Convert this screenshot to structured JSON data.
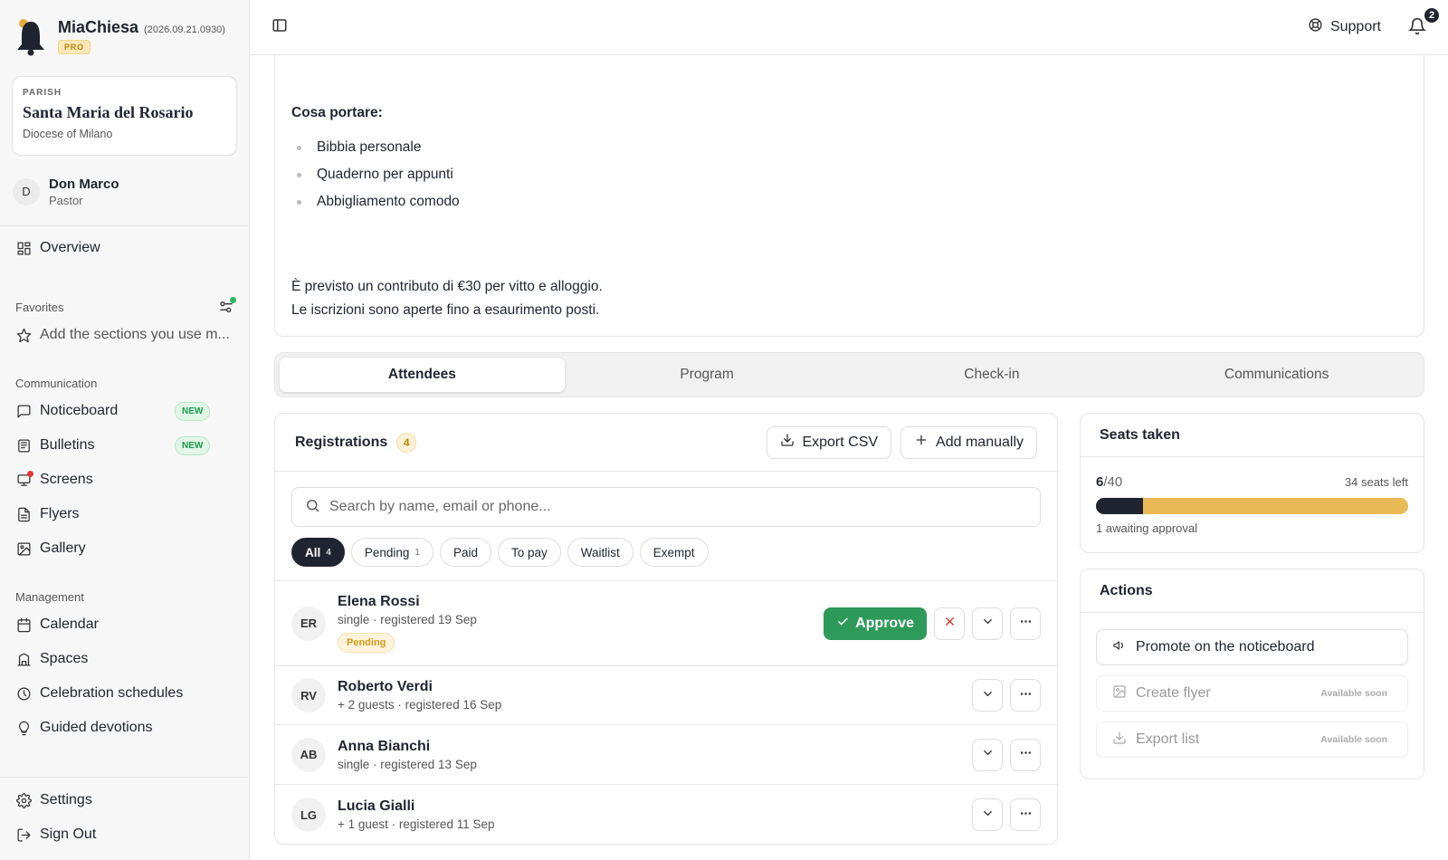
{
  "brand": {
    "name": "MiaChiesa",
    "version": "(2026.09.21.0930)",
    "tier": "PRO"
  },
  "parish": {
    "label": "PARISH",
    "name": "Santa Maria del Rosario",
    "diocese": "Diocese of Milano"
  },
  "user": {
    "initial": "D",
    "name": "Don Marco",
    "role": "Pastor"
  },
  "nav": {
    "overview": "Overview",
    "favorites_label": "Favorites",
    "favorites_hint": "Add the sections you use m...",
    "communication_label": "Communication",
    "noticeboard": "Noticeboard",
    "bulletins": "Bulletins",
    "new_badge": "NEW",
    "screens": "Screens",
    "flyers": "Flyers",
    "gallery": "Gallery",
    "management_label": "Management",
    "calendar": "Calendar",
    "spaces": "Spaces",
    "celebration": "Celebration schedules",
    "devotions": "Guided devotions",
    "settings": "Settings",
    "signout": "Sign Out"
  },
  "topbar": {
    "support": "Support",
    "notifications": "2"
  },
  "description": {
    "heading": "Cosa portare:",
    "items": [
      "Bibbia personale",
      "Quaderno per appunti",
      "Abbigliamento comodo"
    ],
    "line1": "È previsto un contributo di €30 per vitto e alloggio.",
    "line2": "Le iscrizioni sono aperte fino a esaurimento posti."
  },
  "tabs": [
    "Attendees",
    "Program",
    "Check-in",
    "Communications"
  ],
  "registrations": {
    "title": "Registrations",
    "count": "4",
    "export": "Export CSV",
    "add": "Add manually",
    "search_placeholder": "Search by name, email or phone...",
    "filters": [
      {
        "label": "All",
        "count": "4"
      },
      {
        "label": "Pending",
        "count": "1"
      },
      {
        "label": "Paid",
        "count": ""
      },
      {
        "label": "To pay",
        "count": ""
      },
      {
        "label": "Waitlist",
        "count": ""
      },
      {
        "label": "Exempt",
        "count": ""
      }
    ],
    "approve": "Approve",
    "pending_badge": "Pending",
    "rows": [
      {
        "initials": "ER",
        "name": "Elena Rossi",
        "meta": "single · registered 19 Sep"
      },
      {
        "initials": "RV",
        "name": "Roberto Verdi",
        "meta": "+ 2 guests · registered 16 Sep"
      },
      {
        "initials": "AB",
        "name": "Anna Bianchi",
        "meta": "single · registered 13 Sep"
      },
      {
        "initials": "LG",
        "name": "Lucia Gialli",
        "meta": "+ 1 guest · registered 11 Sep"
      }
    ]
  },
  "seats": {
    "title": "Seats taken",
    "taken": "6",
    "total": "/40",
    "left": "34 seats left",
    "awaiting": "1 awaiting approval",
    "fill_fraction": 0.15
  },
  "actions": {
    "title": "Actions",
    "promote": "Promote on the noticeboard",
    "flyer": "Create flyer",
    "export": "Export list",
    "soon": "Available soon"
  },
  "colors": {
    "accent": "#1f2430",
    "approve": "#2e9a5a",
    "seats_bar": "#e9b955",
    "new_badge": "#1a9a4b"
  }
}
